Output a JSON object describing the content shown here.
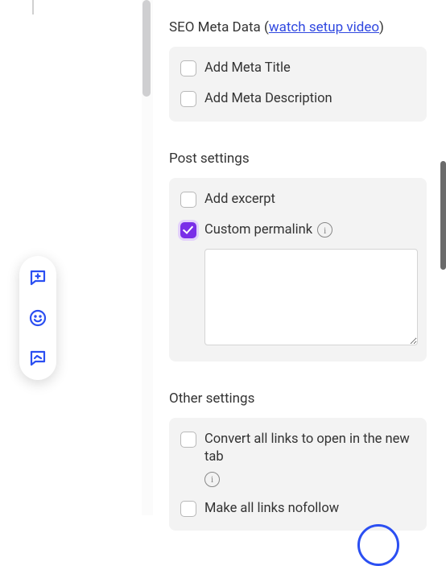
{
  "seo": {
    "title_prefix": "SEO Meta Data (",
    "watch_video": "watch setup video",
    "title_suffix": ")",
    "add_meta_title": "Add Meta Title",
    "add_meta_description": "Add Meta Description"
  },
  "post": {
    "title": "Post settings",
    "add_excerpt": "Add excerpt",
    "custom_permalink": "Custom permalink",
    "permalink_value": ""
  },
  "other": {
    "title": "Other settings",
    "convert_links_new_tab": "Convert all links to open in the new tab",
    "make_all_links_nofollow": "Make all links nofollow"
  },
  "info_glyph": "i"
}
